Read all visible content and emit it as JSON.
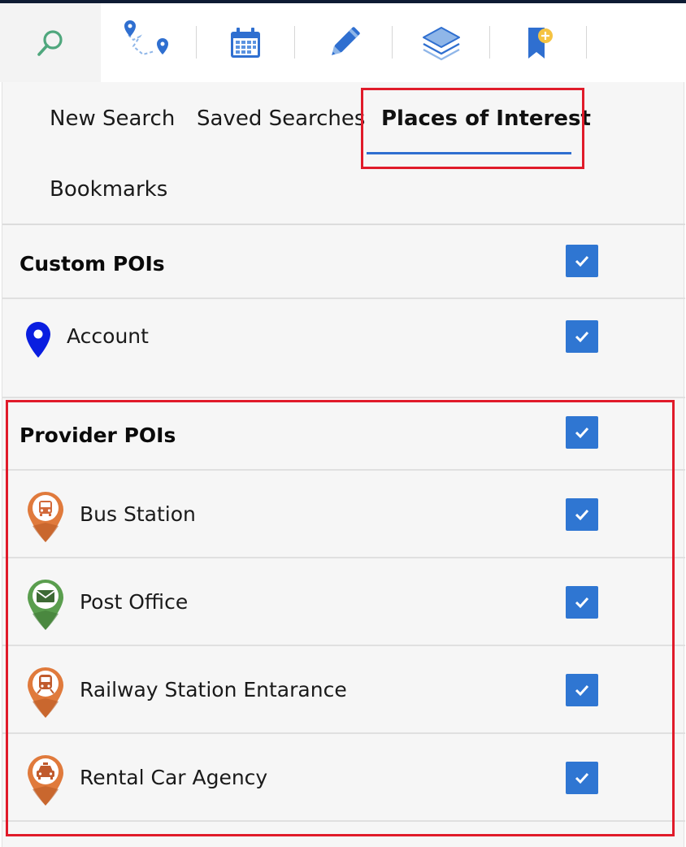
{
  "toolbar": {
    "tools": [
      {
        "name": "search-icon"
      },
      {
        "name": "route-icon"
      },
      {
        "name": "calendar-icon"
      },
      {
        "name": "pencil-icon"
      },
      {
        "name": "layers-icon"
      },
      {
        "name": "bookmark-add-icon"
      }
    ]
  },
  "tabs": {
    "new_search": "New Search",
    "saved_searches": "Saved Searches",
    "places_of_interest": "Places of Interest",
    "bookmarks": "Bookmarks",
    "active": "Places of Interest"
  },
  "custom_pois": {
    "header": "Custom POIs",
    "checked": true,
    "items": [
      {
        "label": "Account",
        "icon": "blue-pin-icon",
        "checked": true
      }
    ]
  },
  "provider_pois": {
    "header": "Provider POIs",
    "checked": true,
    "items": [
      {
        "label": "Bus Station",
        "icon": "bus-pin-icon",
        "color": "#e07a3c",
        "checked": true
      },
      {
        "label": "Post Office",
        "icon": "mail-pin-icon",
        "color": "#5a9e4e",
        "checked": true
      },
      {
        "label": "Railway Station Entarance",
        "icon": "train-pin-icon",
        "color": "#e07a3c",
        "checked": true
      },
      {
        "label": "Rental Car Agency",
        "icon": "taxi-pin-icon",
        "color": "#e07a3c",
        "checked": true
      }
    ]
  },
  "colors": {
    "accent": "#2f76d2",
    "highlight": "#e01b2a",
    "orange_pin": "#e07a3c",
    "green_pin": "#5a9e4e"
  }
}
